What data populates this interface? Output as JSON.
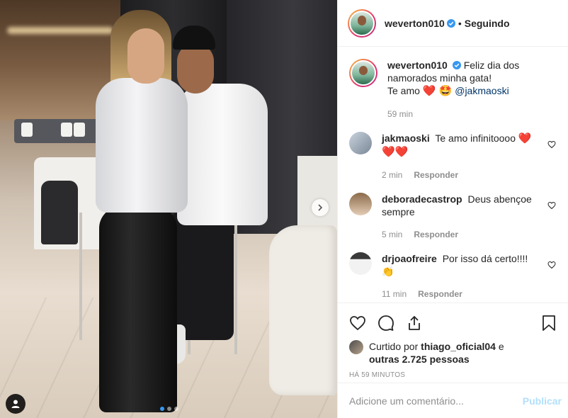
{
  "post": {
    "author": "weverton010",
    "follow_separator": "•",
    "follow_status": "Seguindo",
    "caption_line1": "Feliz dia dos namorados minha gata!",
    "caption_line2_prefix": "Te amo",
    "caption_emojis": "❤️ 🤩",
    "caption_mention": "@jakmaoski",
    "caption_time": "59 min"
  },
  "comments": [
    {
      "user": "jakmaoski",
      "text": "Te amo infinitoooo",
      "emojis": "❤️ ❤️❤️",
      "time": "2 min",
      "reply": "Responder"
    },
    {
      "user": "deboradecastrop",
      "text": "Deus abençoe sempre",
      "emojis": "",
      "time": "5 min",
      "reply": "Responder"
    },
    {
      "user": "drjoaofreire",
      "text": "Por isso dá certo!!!!",
      "emojis": "👏",
      "time": "11 min",
      "reply": "Responder"
    }
  ],
  "likes": {
    "prefix": "Curtido por",
    "user": "thiago_oficial04",
    "conj": "e",
    "others": "outras 2.725 pessoas"
  },
  "timestamp": "HÁ 59 MINUTOS",
  "composer": {
    "placeholder": "Adicione um comentário...",
    "publish_label": "Publicar"
  },
  "carousel": {
    "current": 1,
    "total": 3
  },
  "icons": {
    "verified": "verified-badge-icon",
    "like": "heart-outline-icon",
    "comment": "comment-bubble-icon",
    "share": "share-icon",
    "save": "bookmark-icon",
    "tag": "person-tag-icon",
    "next": "chevron-right-icon"
  },
  "colors": {
    "accent": "#3897f0",
    "text": "#262626",
    "muted": "#8e8e8e",
    "border": "#efefef",
    "publish_disabled": "#b2dffc",
    "mention": "#003569"
  }
}
